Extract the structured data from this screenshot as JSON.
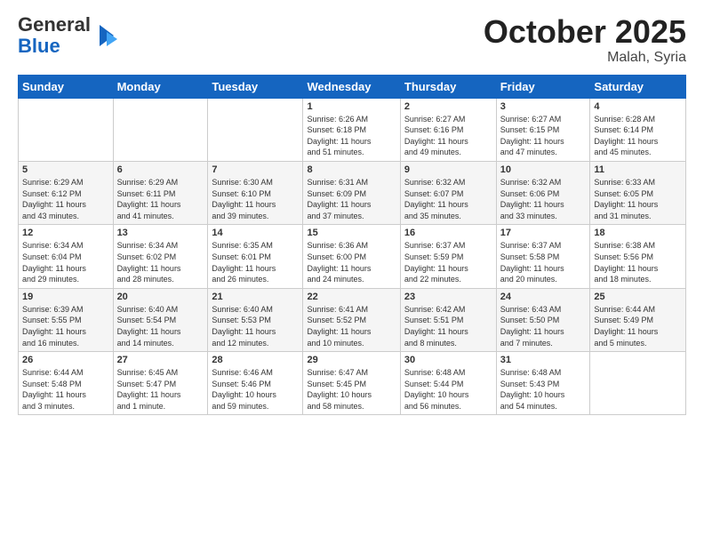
{
  "logo": {
    "general": "General",
    "blue": "Blue"
  },
  "header": {
    "month": "October 2025",
    "location": "Malah, Syria"
  },
  "weekdays": [
    "Sunday",
    "Monday",
    "Tuesday",
    "Wednesday",
    "Thursday",
    "Friday",
    "Saturday"
  ],
  "weeks": [
    [
      {
        "day": "",
        "info": ""
      },
      {
        "day": "",
        "info": ""
      },
      {
        "day": "",
        "info": ""
      },
      {
        "day": "1",
        "info": "Sunrise: 6:26 AM\nSunset: 6:18 PM\nDaylight: 11 hours\nand 51 minutes."
      },
      {
        "day": "2",
        "info": "Sunrise: 6:27 AM\nSunset: 6:16 PM\nDaylight: 11 hours\nand 49 minutes."
      },
      {
        "day": "3",
        "info": "Sunrise: 6:27 AM\nSunset: 6:15 PM\nDaylight: 11 hours\nand 47 minutes."
      },
      {
        "day": "4",
        "info": "Sunrise: 6:28 AM\nSunset: 6:14 PM\nDaylight: 11 hours\nand 45 minutes."
      }
    ],
    [
      {
        "day": "5",
        "info": "Sunrise: 6:29 AM\nSunset: 6:12 PM\nDaylight: 11 hours\nand 43 minutes."
      },
      {
        "day": "6",
        "info": "Sunrise: 6:29 AM\nSunset: 6:11 PM\nDaylight: 11 hours\nand 41 minutes."
      },
      {
        "day": "7",
        "info": "Sunrise: 6:30 AM\nSunset: 6:10 PM\nDaylight: 11 hours\nand 39 minutes."
      },
      {
        "day": "8",
        "info": "Sunrise: 6:31 AM\nSunset: 6:09 PM\nDaylight: 11 hours\nand 37 minutes."
      },
      {
        "day": "9",
        "info": "Sunrise: 6:32 AM\nSunset: 6:07 PM\nDaylight: 11 hours\nand 35 minutes."
      },
      {
        "day": "10",
        "info": "Sunrise: 6:32 AM\nSunset: 6:06 PM\nDaylight: 11 hours\nand 33 minutes."
      },
      {
        "day": "11",
        "info": "Sunrise: 6:33 AM\nSunset: 6:05 PM\nDaylight: 11 hours\nand 31 minutes."
      }
    ],
    [
      {
        "day": "12",
        "info": "Sunrise: 6:34 AM\nSunset: 6:04 PM\nDaylight: 11 hours\nand 29 minutes."
      },
      {
        "day": "13",
        "info": "Sunrise: 6:34 AM\nSunset: 6:02 PM\nDaylight: 11 hours\nand 28 minutes."
      },
      {
        "day": "14",
        "info": "Sunrise: 6:35 AM\nSunset: 6:01 PM\nDaylight: 11 hours\nand 26 minutes."
      },
      {
        "day": "15",
        "info": "Sunrise: 6:36 AM\nSunset: 6:00 PM\nDaylight: 11 hours\nand 24 minutes."
      },
      {
        "day": "16",
        "info": "Sunrise: 6:37 AM\nSunset: 5:59 PM\nDaylight: 11 hours\nand 22 minutes."
      },
      {
        "day": "17",
        "info": "Sunrise: 6:37 AM\nSunset: 5:58 PM\nDaylight: 11 hours\nand 20 minutes."
      },
      {
        "day": "18",
        "info": "Sunrise: 6:38 AM\nSunset: 5:56 PM\nDaylight: 11 hours\nand 18 minutes."
      }
    ],
    [
      {
        "day": "19",
        "info": "Sunrise: 6:39 AM\nSunset: 5:55 PM\nDaylight: 11 hours\nand 16 minutes."
      },
      {
        "day": "20",
        "info": "Sunrise: 6:40 AM\nSunset: 5:54 PM\nDaylight: 11 hours\nand 14 minutes."
      },
      {
        "day": "21",
        "info": "Sunrise: 6:40 AM\nSunset: 5:53 PM\nDaylight: 11 hours\nand 12 minutes."
      },
      {
        "day": "22",
        "info": "Sunrise: 6:41 AM\nSunset: 5:52 PM\nDaylight: 11 hours\nand 10 minutes."
      },
      {
        "day": "23",
        "info": "Sunrise: 6:42 AM\nSunset: 5:51 PM\nDaylight: 11 hours\nand 8 minutes."
      },
      {
        "day": "24",
        "info": "Sunrise: 6:43 AM\nSunset: 5:50 PM\nDaylight: 11 hours\nand 7 minutes."
      },
      {
        "day": "25",
        "info": "Sunrise: 6:44 AM\nSunset: 5:49 PM\nDaylight: 11 hours\nand 5 minutes."
      }
    ],
    [
      {
        "day": "26",
        "info": "Sunrise: 6:44 AM\nSunset: 5:48 PM\nDaylight: 11 hours\nand 3 minutes."
      },
      {
        "day": "27",
        "info": "Sunrise: 6:45 AM\nSunset: 5:47 PM\nDaylight: 11 hours\nand 1 minute."
      },
      {
        "day": "28",
        "info": "Sunrise: 6:46 AM\nSunset: 5:46 PM\nDaylight: 10 hours\nand 59 minutes."
      },
      {
        "day": "29",
        "info": "Sunrise: 6:47 AM\nSunset: 5:45 PM\nDaylight: 10 hours\nand 58 minutes."
      },
      {
        "day": "30",
        "info": "Sunrise: 6:48 AM\nSunset: 5:44 PM\nDaylight: 10 hours\nand 56 minutes."
      },
      {
        "day": "31",
        "info": "Sunrise: 6:48 AM\nSunset: 5:43 PM\nDaylight: 10 hours\nand 54 minutes."
      },
      {
        "day": "",
        "info": ""
      }
    ]
  ]
}
